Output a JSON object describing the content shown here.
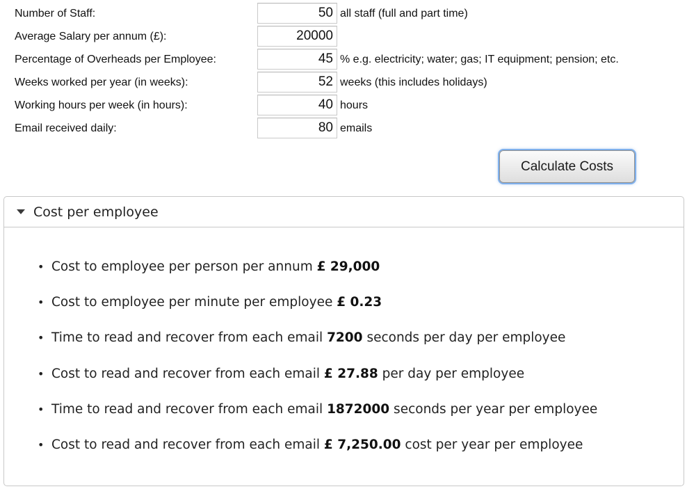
{
  "form": {
    "rows": [
      {
        "label": "Number of Staff:",
        "value": "50",
        "suffix": "all staff (full and part time)"
      },
      {
        "label": "Average Salary per annum (£):",
        "value": "20000",
        "suffix": ""
      },
      {
        "label": "Percentage of Overheads per Employee:",
        "value": "45",
        "suffix": "% e.g. electricity; water; gas; IT equipment; pension; etc."
      },
      {
        "label": "Weeks worked per year (in weeks):",
        "value": "52",
        "suffix": "weeks (this includes holidays)"
      },
      {
        "label": "Working hours per week (in hours):",
        "value": "40",
        "suffix": "hours"
      },
      {
        "label": "Email received daily:",
        "value": "80",
        "suffix": "emails"
      }
    ],
    "calculate_label": "Calculate Costs"
  },
  "panel": {
    "title": "Cost per employee",
    "toggle_icon": "triangle-down-icon",
    "bullet": "•",
    "items": [
      {
        "prefix": "Cost to employee per person per annum ",
        "value": "£ 29,000",
        "suffix": ""
      },
      {
        "prefix": "Cost to employee per minute per employee ",
        "value": "£ 0.23",
        "suffix": ""
      },
      {
        "prefix": "Time to read and recover from each email ",
        "value": "7200",
        "suffix": " seconds per day per employee"
      },
      {
        "prefix": "Cost to read and recover from each email ",
        "value": "£ 27.88",
        "suffix": " per day per employee"
      },
      {
        "prefix": "Time to read and recover from each email ",
        "value": "1872000",
        "suffix": " seconds per year per employee"
      },
      {
        "prefix": "Cost to read and recover from each email ",
        "value": "£ 7,250.00",
        "suffix": " cost per year per employee"
      }
    ]
  },
  "colors": {
    "button_focus_ring": "#7fb0ec",
    "panel_border": "#c8c8c8",
    "text": "#222222"
  }
}
